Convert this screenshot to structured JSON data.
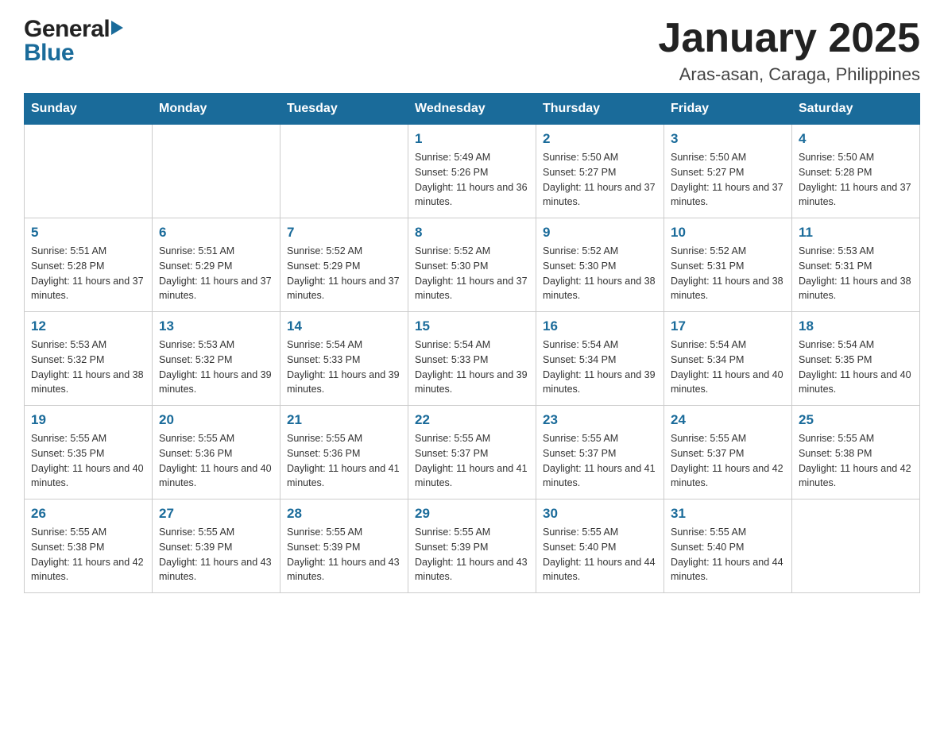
{
  "header": {
    "logo": {
      "text_general": "General",
      "text_blue": "Blue"
    },
    "title": "January 2025",
    "subtitle": "Aras-asan, Caraga, Philippines"
  },
  "days_of_week": [
    "Sunday",
    "Monday",
    "Tuesday",
    "Wednesday",
    "Thursday",
    "Friday",
    "Saturday"
  ],
  "weeks": [
    [
      {
        "day": "",
        "info": ""
      },
      {
        "day": "",
        "info": ""
      },
      {
        "day": "",
        "info": ""
      },
      {
        "day": "1",
        "info": "Sunrise: 5:49 AM\nSunset: 5:26 PM\nDaylight: 11 hours and 36 minutes."
      },
      {
        "day": "2",
        "info": "Sunrise: 5:50 AM\nSunset: 5:27 PM\nDaylight: 11 hours and 37 minutes."
      },
      {
        "day": "3",
        "info": "Sunrise: 5:50 AM\nSunset: 5:27 PM\nDaylight: 11 hours and 37 minutes."
      },
      {
        "day": "4",
        "info": "Sunrise: 5:50 AM\nSunset: 5:28 PM\nDaylight: 11 hours and 37 minutes."
      }
    ],
    [
      {
        "day": "5",
        "info": "Sunrise: 5:51 AM\nSunset: 5:28 PM\nDaylight: 11 hours and 37 minutes."
      },
      {
        "day": "6",
        "info": "Sunrise: 5:51 AM\nSunset: 5:29 PM\nDaylight: 11 hours and 37 minutes."
      },
      {
        "day": "7",
        "info": "Sunrise: 5:52 AM\nSunset: 5:29 PM\nDaylight: 11 hours and 37 minutes."
      },
      {
        "day": "8",
        "info": "Sunrise: 5:52 AM\nSunset: 5:30 PM\nDaylight: 11 hours and 37 minutes."
      },
      {
        "day": "9",
        "info": "Sunrise: 5:52 AM\nSunset: 5:30 PM\nDaylight: 11 hours and 38 minutes."
      },
      {
        "day": "10",
        "info": "Sunrise: 5:52 AM\nSunset: 5:31 PM\nDaylight: 11 hours and 38 minutes."
      },
      {
        "day": "11",
        "info": "Sunrise: 5:53 AM\nSunset: 5:31 PM\nDaylight: 11 hours and 38 minutes."
      }
    ],
    [
      {
        "day": "12",
        "info": "Sunrise: 5:53 AM\nSunset: 5:32 PM\nDaylight: 11 hours and 38 minutes."
      },
      {
        "day": "13",
        "info": "Sunrise: 5:53 AM\nSunset: 5:32 PM\nDaylight: 11 hours and 39 minutes."
      },
      {
        "day": "14",
        "info": "Sunrise: 5:54 AM\nSunset: 5:33 PM\nDaylight: 11 hours and 39 minutes."
      },
      {
        "day": "15",
        "info": "Sunrise: 5:54 AM\nSunset: 5:33 PM\nDaylight: 11 hours and 39 minutes."
      },
      {
        "day": "16",
        "info": "Sunrise: 5:54 AM\nSunset: 5:34 PM\nDaylight: 11 hours and 39 minutes."
      },
      {
        "day": "17",
        "info": "Sunrise: 5:54 AM\nSunset: 5:34 PM\nDaylight: 11 hours and 40 minutes."
      },
      {
        "day": "18",
        "info": "Sunrise: 5:54 AM\nSunset: 5:35 PM\nDaylight: 11 hours and 40 minutes."
      }
    ],
    [
      {
        "day": "19",
        "info": "Sunrise: 5:55 AM\nSunset: 5:35 PM\nDaylight: 11 hours and 40 minutes."
      },
      {
        "day": "20",
        "info": "Sunrise: 5:55 AM\nSunset: 5:36 PM\nDaylight: 11 hours and 40 minutes."
      },
      {
        "day": "21",
        "info": "Sunrise: 5:55 AM\nSunset: 5:36 PM\nDaylight: 11 hours and 41 minutes."
      },
      {
        "day": "22",
        "info": "Sunrise: 5:55 AM\nSunset: 5:37 PM\nDaylight: 11 hours and 41 minutes."
      },
      {
        "day": "23",
        "info": "Sunrise: 5:55 AM\nSunset: 5:37 PM\nDaylight: 11 hours and 41 minutes."
      },
      {
        "day": "24",
        "info": "Sunrise: 5:55 AM\nSunset: 5:37 PM\nDaylight: 11 hours and 42 minutes."
      },
      {
        "day": "25",
        "info": "Sunrise: 5:55 AM\nSunset: 5:38 PM\nDaylight: 11 hours and 42 minutes."
      }
    ],
    [
      {
        "day": "26",
        "info": "Sunrise: 5:55 AM\nSunset: 5:38 PM\nDaylight: 11 hours and 42 minutes."
      },
      {
        "day": "27",
        "info": "Sunrise: 5:55 AM\nSunset: 5:39 PM\nDaylight: 11 hours and 43 minutes."
      },
      {
        "day": "28",
        "info": "Sunrise: 5:55 AM\nSunset: 5:39 PM\nDaylight: 11 hours and 43 minutes."
      },
      {
        "day": "29",
        "info": "Sunrise: 5:55 AM\nSunset: 5:39 PM\nDaylight: 11 hours and 43 minutes."
      },
      {
        "day": "30",
        "info": "Sunrise: 5:55 AM\nSunset: 5:40 PM\nDaylight: 11 hours and 44 minutes."
      },
      {
        "day": "31",
        "info": "Sunrise: 5:55 AM\nSunset: 5:40 PM\nDaylight: 11 hours and 44 minutes."
      },
      {
        "day": "",
        "info": ""
      }
    ]
  ]
}
